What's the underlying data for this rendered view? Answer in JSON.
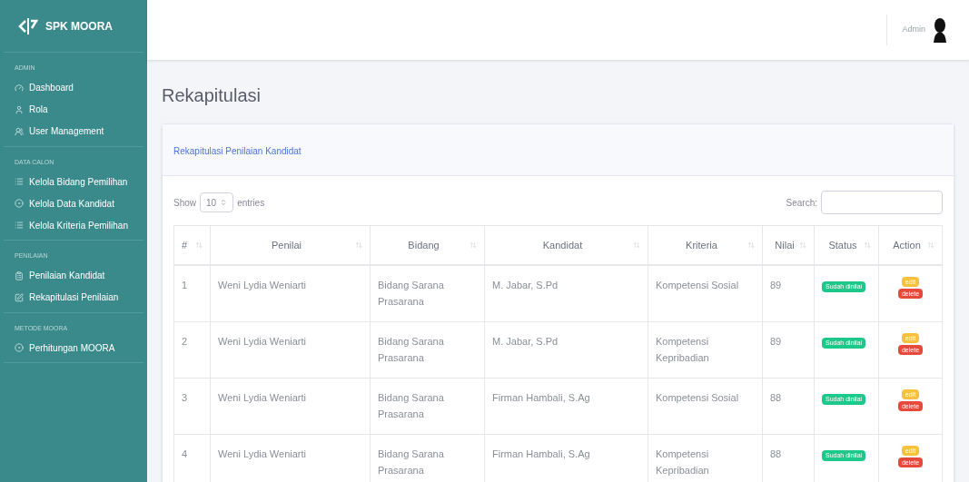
{
  "brand": {
    "name": "SPK MOORA"
  },
  "sidebar": {
    "sections": [
      {
        "heading": "ADMIN",
        "items": [
          {
            "label": "Dashboard",
            "kind": "gauge"
          },
          {
            "label": "Rola",
            "kind": "user"
          },
          {
            "label": "User Management",
            "kind": "users"
          }
        ]
      },
      {
        "heading": "DATA CALON",
        "items": [
          {
            "label": "Kelola Bidang Pemilihan",
            "kind": "list"
          },
          {
            "label": "Kelola Data Kandidat",
            "kind": "circle"
          },
          {
            "label": "Kelola Kriteria Pemilihan",
            "kind": "list"
          }
        ]
      },
      {
        "heading": "PENILAIAN",
        "items": [
          {
            "label": "Penilaian Kandidat",
            "kind": "clipboard"
          },
          {
            "label": "Rekapitulasi Penilaian",
            "kind": "edit"
          }
        ]
      },
      {
        "heading": "METODE MOORA",
        "items": [
          {
            "label": "Perhitungan MOORA",
            "kind": "circle"
          }
        ]
      }
    ]
  },
  "topbar": {
    "user": "Admin"
  },
  "page_title": "Rekapitulasi",
  "card": {
    "title": "Rekapitulasi Penilaian Kandidat",
    "length": {
      "prefix": "Show",
      "value": "10",
      "suffix": "entries"
    },
    "search": {
      "label": "Search:"
    },
    "table": {
      "columns": [
        "#",
        "Penilai",
        "Bidang",
        "Kandidat",
        "Kriteria",
        "Nilai",
        "Status",
        "Action"
      ],
      "rows": [
        {
          "no": "1",
          "penilai": "Weni Lydia Weniarti",
          "bidang": "Bidang Sarana Prasarana",
          "kandidat": "M. Jabar, S.Pd",
          "kriteria": "Kompetensi Sosial",
          "nilai": "89",
          "status": "Sudah dinilai",
          "actions": [
            "edit",
            "delete"
          ]
        },
        {
          "no": "2",
          "penilai": "Weni Lydia Weniarti",
          "bidang": "Bidang Sarana Prasarana",
          "kandidat": "M. Jabar, S.Pd",
          "kriteria": "Kompetensi Kepribadian",
          "nilai": "89",
          "status": "Sudah dinilai",
          "actions": [
            "edit",
            "delete"
          ]
        },
        {
          "no": "3",
          "penilai": "Weni Lydia Weniarti",
          "bidang": "Bidang Sarana Prasarana",
          "kandidat": "Firman Hambali, S.Ag",
          "kriteria": "Kompetensi Sosial",
          "nilai": "88",
          "status": "Sudah dinilai",
          "actions": [
            "edit",
            "delete"
          ]
        },
        {
          "no": "4",
          "penilai": "Weni Lydia Weniarti",
          "bidang": "Bidang Sarana Prasarana",
          "kandidat": "Firman Hambali, S.Ag",
          "kriteria": "Kompetensi Kepribadian",
          "nilai": "88",
          "status": "Sudah dinilai",
          "actions": [
            "edit",
            "delete"
          ]
        }
      ]
    }
  }
}
